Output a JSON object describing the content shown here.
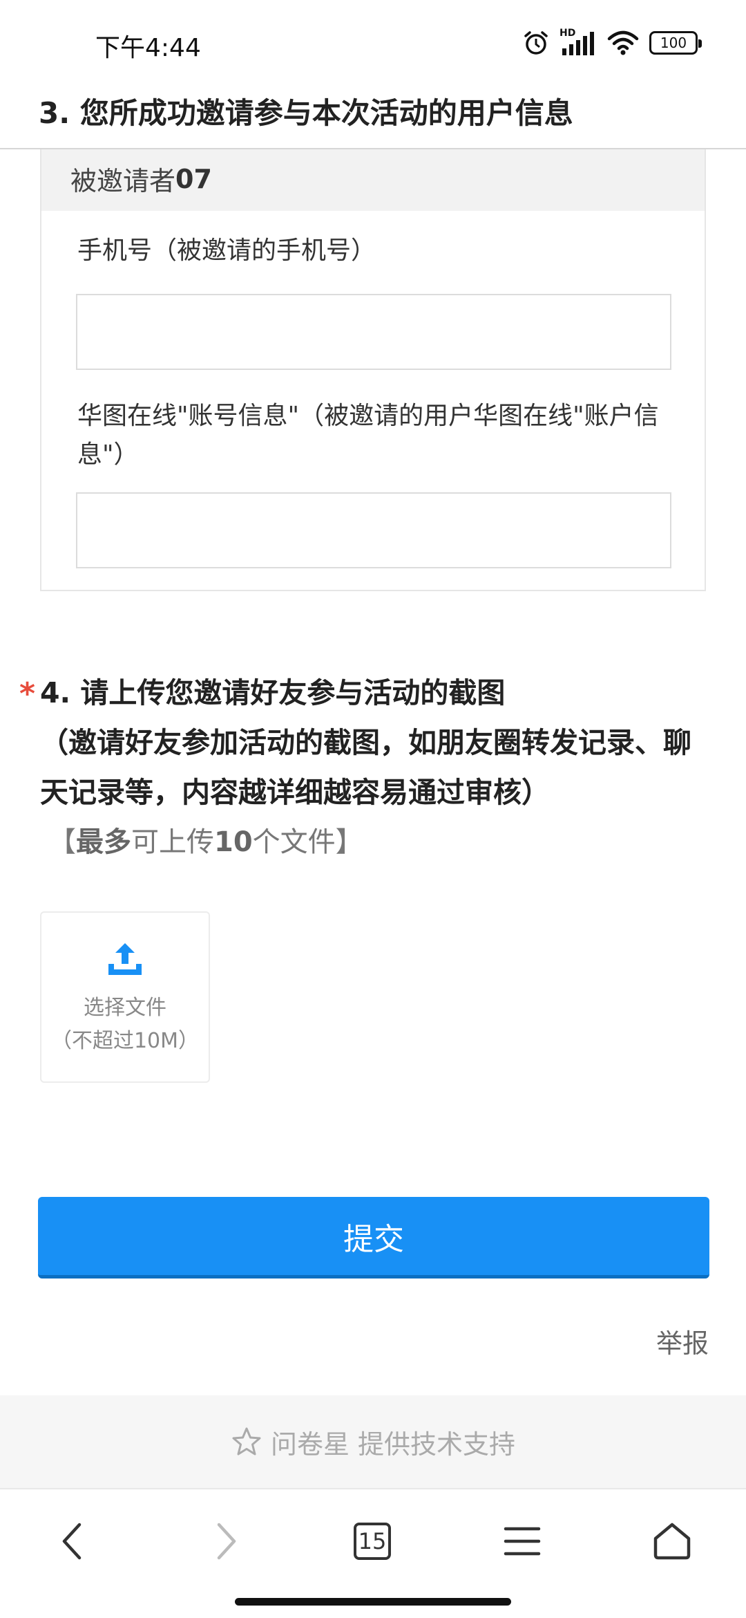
{
  "status_bar": {
    "time": "下午4:44",
    "hd_label": "HD",
    "battery": "100"
  },
  "section3": {
    "title": "3. 您所成功邀请参与本次活动的用户信息"
  },
  "invitee": {
    "prefix": "被邀请者",
    "number": "07",
    "phone_label": "手机号（被邀请的手机号）",
    "phone_value": "",
    "account_label": "华图在线\"账号信息\"（被邀请的用户华图在线\"账户信息\"）",
    "account_value": ""
  },
  "section4": {
    "required_mark": "*",
    "title": "4. 请上传您邀请好友参与活动的截图",
    "description": "（邀请好友参加活动的截图，如朋友圈转发记录、聊天记录等，内容越详细越容易通过审核）",
    "limit_open": "【",
    "limit_bold1": "最多",
    "limit_text1": "可上传",
    "limit_bold2": "10",
    "limit_text2": "个文件】"
  },
  "upload": {
    "label": "选择文件",
    "size_note": "（不超过10M）",
    "icon": "upload-icon"
  },
  "submit_label": "提交",
  "report_label": "举报",
  "brand": {
    "text": "问卷星 提供技术支持",
    "icon": "star-outline-icon"
  },
  "browser_nav": {
    "tab_count": "15",
    "icons": [
      "back-icon",
      "forward-icon",
      "tabs-icon",
      "menu-icon",
      "home-icon"
    ]
  },
  "colors": {
    "primary": "#1890f5",
    "required": "#e74c3c",
    "muted": "#888888"
  }
}
